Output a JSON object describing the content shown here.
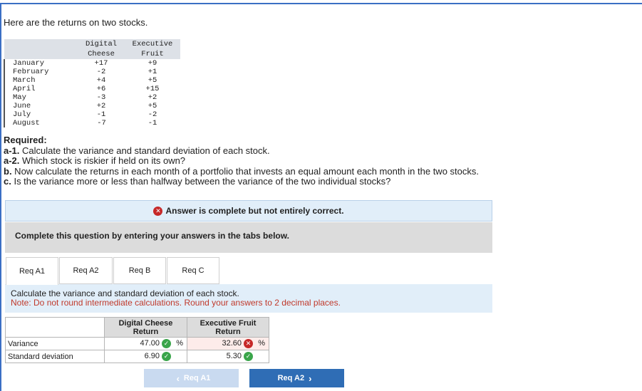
{
  "intro": "Here are the returns on two stocks.",
  "stock_table": {
    "headers": [
      [
        "",
        "Digital",
        "Executive"
      ],
      [
        "",
        "Cheese",
        "Fruit"
      ]
    ],
    "rows": [
      [
        "January",
        "+17",
        "+9"
      ],
      [
        "February",
        "-2",
        "+1"
      ],
      [
        "March",
        "+4",
        "+5"
      ],
      [
        "April",
        "+6",
        "+15"
      ],
      [
        "May",
        "-3",
        "+2"
      ],
      [
        "June",
        "+2",
        "+5"
      ],
      [
        "July",
        "-1",
        "-2"
      ],
      [
        "August",
        "-7",
        "-1"
      ]
    ]
  },
  "required": {
    "title": "Required:",
    "items": [
      {
        "key": "a-1.",
        "text": " Calculate the variance and standard deviation of each stock."
      },
      {
        "key": "a-2.",
        "text": " Which stock is riskier if held on its own?"
      },
      {
        "key": "b.",
        "text": " Now calculate the returns in each month of a portfolio that invests an equal amount each month in the two stocks."
      },
      {
        "key": "c.",
        "text": " Is the variance more or less than halfway between the variance of the two individual stocks?"
      }
    ]
  },
  "banner": {
    "icon": "x-circle-icon",
    "text": "Answer is complete but not entirely correct."
  },
  "instruction": "Complete this question by entering your answers in the tabs below.",
  "tabs": [
    {
      "label": "Req A1",
      "active": true
    },
    {
      "label": "Req A2",
      "active": false
    },
    {
      "label": "Req B",
      "active": false
    },
    {
      "label": "Req C",
      "active": false
    }
  ],
  "panel": {
    "text": "Calculate the variance and standard deviation of each stock.",
    "note": "Note: Do not round intermediate calculations. Round your answers to 2 decimal places."
  },
  "answer_table": {
    "col1_header": [
      "Digital Cheese",
      "Return"
    ],
    "col2_header": [
      "Executive Fruit",
      "Return"
    ],
    "rows": [
      {
        "label": "Variance",
        "v1": "47.00",
        "s1": "correct",
        "u1": "%",
        "v2": "32.60",
        "s2": "incorrect",
        "u2": "%"
      },
      {
        "label": "Standard deviation",
        "v1": "6.90",
        "s1": "correct",
        "u1": "",
        "v2": "5.30",
        "s2": "correct",
        "u2": ""
      }
    ]
  },
  "nav": {
    "prev": "Req A1",
    "next": "Req A2"
  },
  "colors": {
    "accent": "#2f6db5",
    "error": "#c62828",
    "ok": "#3aa54a",
    "note": "#c0392b"
  }
}
